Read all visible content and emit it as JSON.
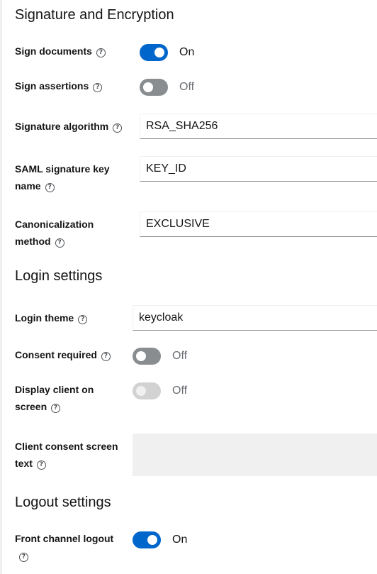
{
  "signature": {
    "heading": "Signature and Encryption",
    "sign_documents": {
      "label": "Sign documents",
      "state": "On"
    },
    "sign_assertions": {
      "label": "Sign assertions",
      "state": "Off"
    },
    "signature_algorithm": {
      "label": "Signature algorithm",
      "value": "RSA_SHA256"
    },
    "saml_key_name": {
      "label_line1": "SAML signature key",
      "label_line2": "name",
      "value": "KEY_ID"
    },
    "canonicalization": {
      "label_line1": "Canonicalization",
      "label_line2": "method",
      "value": "EXCLUSIVE"
    }
  },
  "login": {
    "heading": "Login settings",
    "login_theme": {
      "label": "Login theme",
      "value": "keycloak"
    },
    "consent_required": {
      "label": "Consent required",
      "state": "Off"
    },
    "display_client": {
      "label_line1": "Display client on",
      "label_line2": "screen",
      "state": "Off"
    },
    "consent_text": {
      "label_line1": "Client consent screen",
      "label_line2": "text",
      "value": ""
    }
  },
  "logout": {
    "heading": "Logout settings",
    "front_channel": {
      "label": "Front channel logout",
      "state": "On"
    }
  },
  "icons": {
    "help": "?"
  },
  "colors": {
    "toggle_on": "#0066cc",
    "toggle_off": "#8a8d90",
    "toggle_disabled": "#d2d2d2",
    "text": "#151515",
    "muted_text": "#6a6e73"
  }
}
